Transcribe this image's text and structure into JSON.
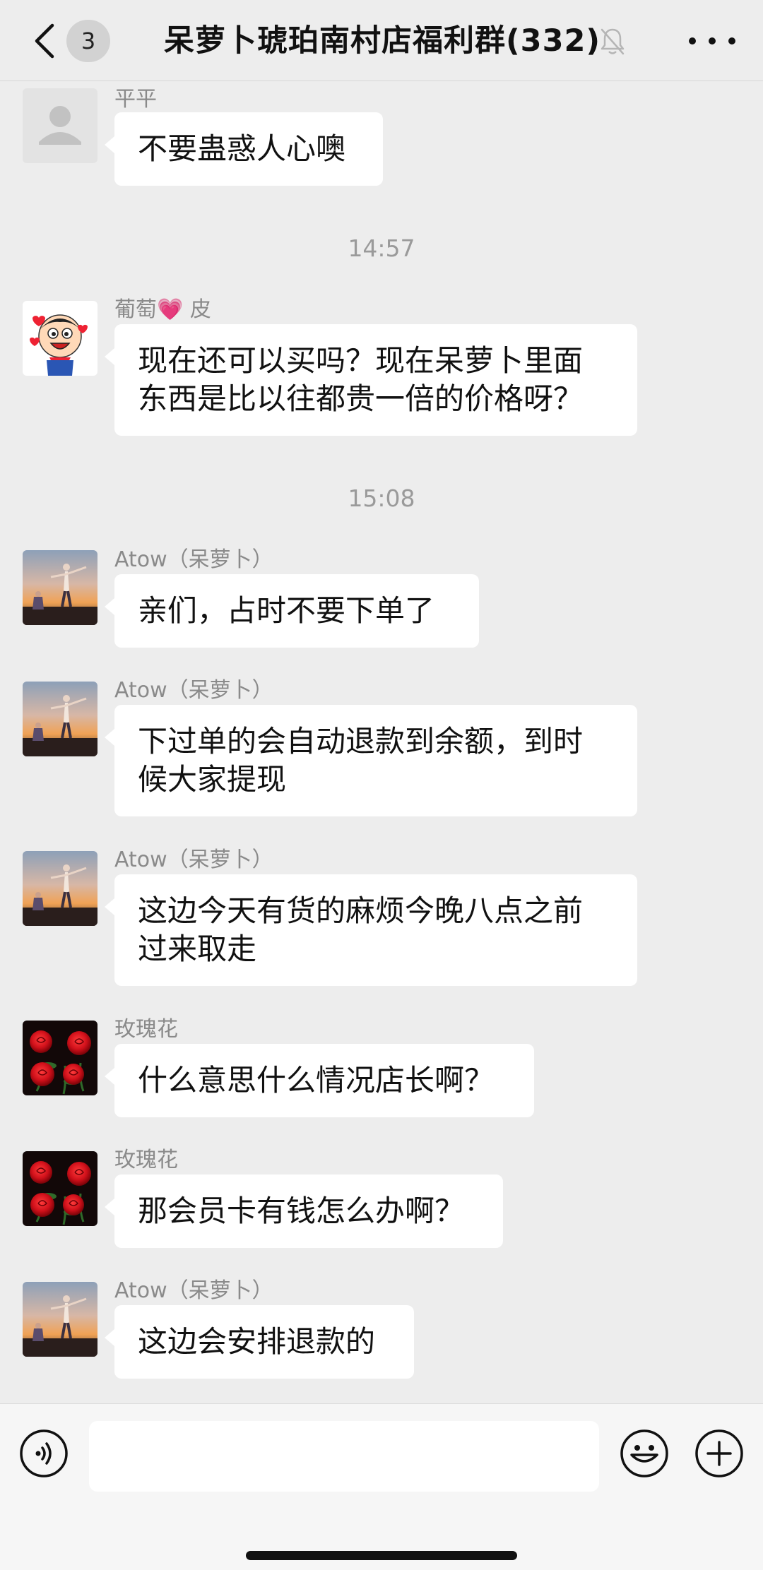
{
  "header": {
    "unread_badge": "3",
    "title": "呆萝卜琥珀南村店福利群(332)"
  },
  "chat": {
    "messages": [
      {
        "sender": "平平",
        "text": "不要蛊惑人心噢",
        "avatar": "default-person-icon"
      },
      {
        "timestamp": "14:57"
      },
      {
        "sender_name": "葡萄",
        "sender_emoji": "💗",
        "sender_suffix": " 皮",
        "line1": "现在还可以买吗？现在呆萝卜里面",
        "line2": "东西是比以往都贵一倍的价格呀？",
        "avatar": "cartoon-boy"
      },
      {
        "timestamp": "15:08"
      },
      {
        "sender": "Atow（呆萝卜）",
        "text": "亲们，占时不要下单了",
        "avatar": "sunset-child-photo"
      },
      {
        "sender": "Atow（呆萝卜）",
        "line1": "下过单的会自动退款到余额，到时",
        "line2": "候大家提现",
        "avatar": "sunset-child-photo"
      },
      {
        "sender": "Atow（呆萝卜）",
        "line1": "这边今天有货的麻烦今晚八点之前",
        "line2": "过来取走",
        "avatar": "sunset-child-photo"
      },
      {
        "sender": "玫瑰花",
        "text": "什么意思什么情况店长啊？",
        "avatar": "red-roses-photo"
      },
      {
        "sender": "玫瑰花",
        "text": "那会员卡有钱怎么办啊？",
        "avatar": "red-roses-photo"
      },
      {
        "sender": "Atow（呆萝卜）",
        "text": "这边会安排退款的",
        "avatar": "sunset-child-photo"
      }
    ]
  },
  "input_bar": {
    "placeholder": "",
    "icons": [
      "voice-icon",
      "emoji-icon",
      "plus-icon"
    ]
  },
  "colors": {
    "background": "#ededed",
    "bubble": "#ffffff",
    "timestamp": "#9a9a9a",
    "sender": "#8a8a8a"
  }
}
